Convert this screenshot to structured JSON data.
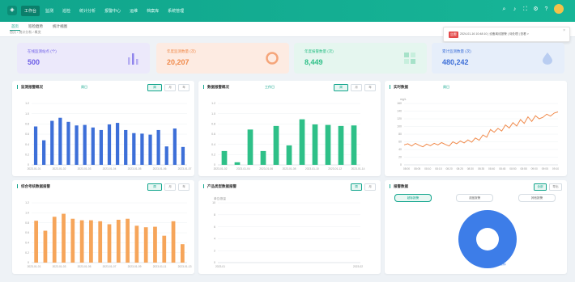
{
  "nav": {
    "items": [
      "工作台",
      "监测",
      "巡检",
      "统计分析",
      "报警中心",
      "运维",
      "档案库",
      "系统管理"
    ],
    "active_index": 0
  },
  "tabs": {
    "items": [
      "首页",
      "巡检趋势",
      "统计视图"
    ],
    "active_index": 0
  },
  "breadcrumb": "首页 / 统计分析 / 概览",
  "notification": {
    "tag": "告警",
    "text": "2024-01-16 10:48:10 | 设备离线报警 | 待处理 | 查看 >"
  },
  "stats": [
    {
      "label": "在线监测站点 (个)",
      "value": "500",
      "bg": "#ece9fb",
      "color": "#6c5ce7",
      "icon": "bar-chart-icon"
    },
    {
      "label": "年度监测数量 (次)",
      "value": "20,207",
      "bg": "#fdebe2",
      "color": "#f08a4b",
      "icon": "ring-icon"
    },
    {
      "label": "年度报警数量 (次)",
      "value": "8,449",
      "bg": "#e5f6ef",
      "color": "#2ec088",
      "icon": "grid-icon"
    },
    {
      "label": "累计监测数量 (次)",
      "value": "480,242",
      "bg": "#e6eefa",
      "color": "#3d6fd8",
      "icon": "drop-icon"
    }
  ],
  "cards": {
    "c1": {
      "title": "监测报警概况",
      "filter": "周日",
      "buttons": [
        "周",
        "月",
        "年"
      ]
    },
    "c2": {
      "title": "数据报警概况",
      "filter": "工作日",
      "buttons": [
        "周",
        "月",
        "年"
      ]
    },
    "c3": {
      "title": "实时数据",
      "filter": "周日"
    },
    "c4": {
      "title": "综合考核数据报警",
      "buttons": [
        "周",
        "月",
        "年"
      ]
    },
    "c5": {
      "title": "产品类型数据报警",
      "buttons": [
        "周",
        "月"
      ]
    },
    "c6": {
      "title": "报警数据",
      "buttons": [
        "全部",
        "导出"
      ],
      "pills": [
        "超标报警",
        "浓度报警",
        "其他报警"
      ]
    }
  },
  "chart_data": [
    {
      "type": "bar",
      "color": "#3d6fd8",
      "ylabel": "",
      "ylim": [
        0,
        1.2
      ],
      "yticks": [
        "0",
        "0.2",
        "0.4",
        "0.6",
        "0.8",
        "1.0",
        "1.2"
      ],
      "xticks": [
        "2023-01-01",
        "2023-01-02",
        "2023-01-03",
        "2023-01-04",
        "2023-01-05",
        "2023-01-06",
        "2023-01-07"
      ],
      "values": [
        0.75,
        0.48,
        0.86,
        0.92,
        0.84,
        0.77,
        0.78,
        0.73,
        0.68,
        0.79,
        0.82,
        0.68,
        0.62,
        0.61,
        0.59,
        0.68,
        0.36,
        0.71,
        0.35
      ]
    },
    {
      "type": "bar",
      "color": "#2ec088",
      "ylabel": "",
      "ylim": [
        0,
        1.2
      ],
      "yticks": [
        "0",
        "0.2",
        "0.4",
        "0.6",
        "0.8",
        "1.0",
        "1.2"
      ],
      "xticks": [
        "2023-01-02",
        "2023-01-04",
        "2023-01-06",
        "2023-01-08",
        "2023-01-10",
        "2023-01-12",
        "2023-01-14"
      ],
      "values": [
        0.27,
        0.05,
        0.69,
        0.27,
        0.76,
        0.38,
        0.89,
        0.79,
        0.78,
        0.76,
        0.77
      ]
    },
    {
      "type": "line",
      "color": "#f08a4b",
      "ylabel": "mg/L",
      "ylim": [
        0,
        160
      ],
      "yticks": [
        "0",
        "20",
        "40",
        "60",
        "80",
        "100",
        "120",
        "140",
        "160"
      ],
      "xticks": [
        "08:00",
        "08:05",
        "08:10",
        "08:15",
        "08:20",
        "08:25",
        "08:30",
        "08:35",
        "08:40",
        "08:45",
        "08:50",
        "08:55",
        "09:00",
        "09:05",
        "09:10"
      ],
      "values": [
        52,
        55,
        49,
        56,
        51,
        47,
        54,
        50,
        56,
        52,
        58,
        53,
        49,
        60,
        55,
        62,
        57,
        65,
        59,
        70,
        64,
        78,
        72,
        92,
        85,
        95,
        88,
        104,
        96,
        110,
        101,
        118,
        108,
        125,
        113,
        128,
        120,
        124,
        132,
        127,
        135,
        138
      ]
    },
    {
      "type": "bar",
      "color": "#f6a55a",
      "ylabel": "",
      "ylim": [
        0,
        1.2
      ],
      "yticks": [
        "0",
        "0.2",
        "0.4",
        "0.6",
        "0.8",
        "1.0",
        "1.2"
      ],
      "xticks": [
        "2023-01-01",
        "2023-01-03",
        "2023-01-05",
        "2023-01-07",
        "2023-01-09",
        "2023-01-11",
        "2023-01-13"
      ],
      "values": [
        0.84,
        0.64,
        0.92,
        0.98,
        0.88,
        0.85,
        0.85,
        0.83,
        0.77,
        0.86,
        0.88,
        0.74,
        0.71,
        0.72,
        0.54,
        0.83,
        0.37
      ]
    },
    {
      "type": "line",
      "color": "#2ec088",
      "ylabel": "单位/数量",
      "ylim": [
        0,
        10
      ],
      "yticks": [
        "0",
        "2",
        "4",
        "6",
        "8",
        "10"
      ],
      "xticks": [
        "2023-01",
        "2023-02"
      ],
      "values": []
    },
    {
      "type": "pie",
      "slices": [
        {
          "name": "超标",
          "value": 1
        }
      ],
      "colors": [
        "#3d7de8"
      ],
      "legend": "超标"
    }
  ]
}
